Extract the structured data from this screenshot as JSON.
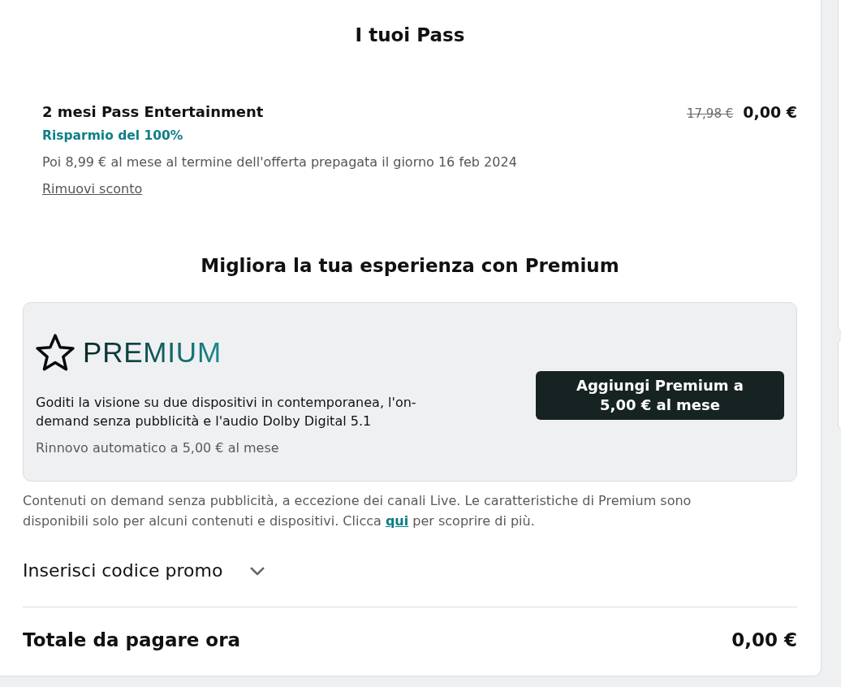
{
  "page_title": "I tuoi Pass",
  "pass": {
    "name": "2 mesi Pass Entertainment",
    "old_price": "17,98 €",
    "price": "0,00 €",
    "savings": "Risparmio del 100%",
    "renewal_note": "Poi 8,99 € al mese al termine dell'offerta prepagata il giorno 16 feb 2024",
    "remove_link": "Rimuovi sconto"
  },
  "upsell": {
    "heading": "Migliora la tua esperienza con Premium",
    "logo_text": "PREMIUM",
    "description": "Goditi la visione su due dispositivi in contemporanea, l'on-demand senza pubblicità e l'audio Dolby Digital 5.1",
    "renewal": "Rinnovo automatico a 5,00 € al mese",
    "button": "Aggiungi Premium a 5,00 € al mese"
  },
  "disclaimer": {
    "text_before": "Contenuti on demand senza pubblicità, a eccezione dei canali Live. Le caratteristiche di Premium sono disponibili solo per alcuni contenuti e dispositivi. Clicca",
    "link": "qui",
    "text_after": "per scoprire di più."
  },
  "promo": {
    "label": "Inserisci codice promo",
    "expanded": false
  },
  "total": {
    "label": "Totale da pagare ora",
    "amount": "0,00 €"
  }
}
